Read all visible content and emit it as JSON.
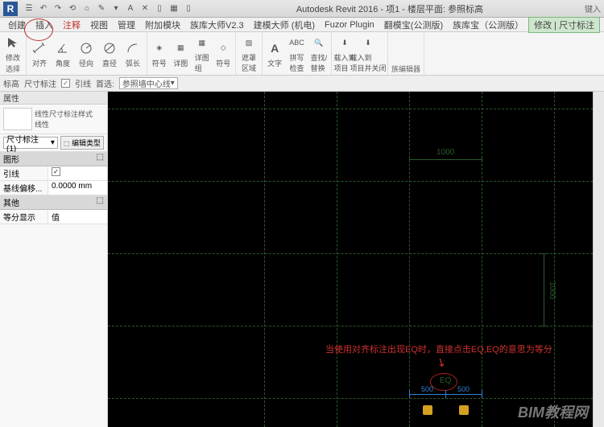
{
  "app_icon_letter": "R",
  "title": "Autodesk Revit 2016 - 项1 - 楼层平面: 参照标高",
  "title_right": "键入",
  "qat": [
    "☰",
    "↶",
    "↷",
    "⟲",
    "⌂",
    "✎",
    "▾",
    "A",
    "✕",
    "▯",
    "▦",
    "▯"
  ],
  "menu": {
    "items": [
      "创建",
      "插入",
      "注释",
      "视图",
      "管理",
      "附加模块",
      "族库大师V2.3",
      "建模大师 (机电)",
      "Fuzor Plugin",
      "翻模宝(公测版)",
      "族库宝（公测版）",
      "修改 | 尺寸标注"
    ],
    "active_index": 11
  },
  "ribbon": {
    "groups": [
      {
        "label": "选择",
        "items": [
          {
            "icon": "cursor",
            "label": "修改"
          }
        ]
      },
      {
        "label": "",
        "items": [
          {
            "icon": "align",
            "label": "对齐"
          },
          {
            "icon": "angle",
            "label": "角度"
          },
          {
            "icon": "radial",
            "label": "径向"
          },
          {
            "icon": "diameter",
            "label": "直径"
          },
          {
            "icon": "arc",
            "label": "弧长"
          }
        ]
      },
      {
        "label": "",
        "items": [
          {
            "icon": "symbol",
            "label": "符号"
          },
          {
            "icon": "detail",
            "label": "详图"
          },
          {
            "icon": "detail",
            "label": "详图\n组"
          },
          {
            "icon": "symbol",
            "label": "符号"
          }
        ]
      },
      {
        "label": "",
        "items": [
          {
            "icon": "mask",
            "label": "遮罩\n区域"
          }
        ]
      },
      {
        "label": "",
        "items": [
          {
            "icon": "text",
            "label": "文字"
          },
          {
            "icon": "spell",
            "label": "拼写\n检查"
          },
          {
            "icon": "find",
            "label": "查找/\n替换"
          }
        ]
      },
      {
        "label": "",
        "items": [
          {
            "icon": "load",
            "label": "载入到\n项目"
          },
          {
            "icon": "load",
            "label": "载入到\n项目并关闭"
          }
        ]
      },
      {
        "label": "族编辑器",
        "items": []
      }
    ]
  },
  "optbar": {
    "left1": "标高",
    "left2": "尺寸标注",
    "chk_label": "引线",
    "dd_label": "首选:",
    "dd_value": "参照墙中心线"
  },
  "props": {
    "header": "属性",
    "type_name": "线性尺寸标注样式\n线性",
    "instance": "尺寸标注 (1)",
    "edit_type": "编辑类型",
    "sections": [
      {
        "name": "图形",
        "rows": [
          [
            "引线",
            "☑"
          ],
          [
            "基线偏移...",
            "0.0000 mm"
          ]
        ]
      },
      {
        "name": "其他",
        "rows": [
          [
            "等分显示",
            "值"
          ]
        ]
      }
    ]
  },
  "canvas": {
    "dim_1000_h": "1000",
    "dim_1000_v": "1000",
    "annotation": "当使用对齐标注出现EQ时，直接点击EQ,EQ的意思为等分",
    "eq": "EQ",
    "blue_left": "500",
    "blue_right": "500",
    "watermark": "BIM教程网"
  },
  "chart_data": {
    "type": "diagram",
    "grid_spacing": 1000,
    "dimension_segments": [
      500,
      500
    ],
    "eq_constraint": true
  }
}
